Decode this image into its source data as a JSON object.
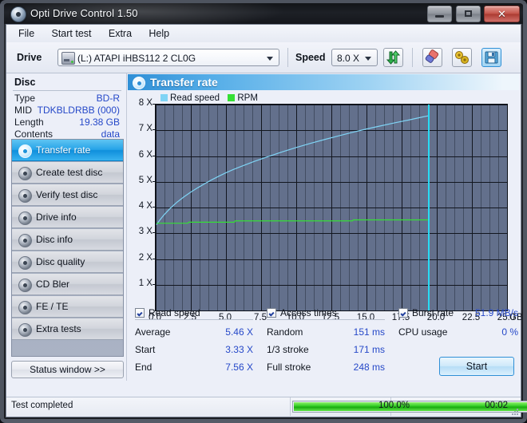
{
  "window": {
    "title": "Opti Drive Control 1.50",
    "app_icon": "disc-icon",
    "minimize": "minimize-icon",
    "maximize": "maximize-icon",
    "close": "✕"
  },
  "menubar": {
    "items": [
      {
        "label": "File"
      },
      {
        "label": "Start test"
      },
      {
        "label": "Extra"
      },
      {
        "label": "Help"
      }
    ]
  },
  "toolbar": {
    "drive_label": "Drive",
    "drive_value": "(L:)  ATAPI iHBS112  2 CL0G",
    "drive_icon": "optical-drive-icon",
    "speed_label": "Speed",
    "speed_value": "8.0 X",
    "refresh_icon": "refresh-icon",
    "eraser_icon": "eraser-icon",
    "settings_icon": "settings-icon",
    "save_icon": "save-icon"
  },
  "disc": {
    "title": "Disc",
    "rows": [
      {
        "key": "Type",
        "value": "BD-R"
      },
      {
        "key": "MID",
        "value": "TDKBLDRBB (000)"
      },
      {
        "key": "Length",
        "value": "19.38 GB"
      },
      {
        "key": "Contents",
        "value": "data"
      }
    ]
  },
  "nav": {
    "items": [
      {
        "label": "Transfer rate",
        "active": true
      },
      {
        "label": "Create test disc",
        "active": false
      },
      {
        "label": "Verify test disc",
        "active": false
      },
      {
        "label": "Drive info",
        "active": false
      },
      {
        "label": "Disc info",
        "active": false
      },
      {
        "label": "Disc quality",
        "active": false
      },
      {
        "label": "CD Bler",
        "active": false
      },
      {
        "label": "FE / TE",
        "active": false
      },
      {
        "label": "Extra tests",
        "active": false
      }
    ],
    "status_window_label": "Status window >>"
  },
  "panel": {
    "title": "Transfer rate",
    "icon": "disc-icon"
  },
  "chart_data": {
    "type": "line",
    "title": "Transfer rate",
    "xlabel": "GB",
    "ylabel": "X",
    "xlim": [
      0.0,
      25.0
    ],
    "ylim": [
      0,
      8
    ],
    "xticks": [
      "0.0",
      "2.5",
      "5.0",
      "7.5",
      "10.0",
      "12.5",
      "15.0",
      "17.5",
      "20.0",
      "22.5",
      "25.0"
    ],
    "xtick_values": [
      0.0,
      2.5,
      5.0,
      7.5,
      10.0,
      12.5,
      15.0,
      17.5,
      20.0,
      22.5,
      25.0
    ],
    "x_unit": "GB",
    "yticks": [
      "1 X",
      "2 X",
      "3 X",
      "4 X",
      "5 X",
      "6 X",
      "7 X",
      "8 X"
    ],
    "ytick_values": [
      1,
      2,
      3,
      4,
      5,
      6,
      7,
      8
    ],
    "grid": true,
    "legend": [
      {
        "name": "Read speed",
        "color": "#7fd4f5"
      },
      {
        "name": "RPM",
        "color": "#35e035"
      }
    ],
    "cursor_x": 19.38,
    "cursor_color": "#27dbf5",
    "plot_bg": "#63708c",
    "series": [
      {
        "name": "Read speed",
        "color": "#7fd4f5",
        "x": [
          0.05,
          0.3,
          0.6,
          1.0,
          1.5,
          2.0,
          2.5,
          3.0,
          3.5,
          4.0,
          4.5,
          5.0,
          5.5,
          6.0,
          7.0,
          8.0,
          9.0,
          10.0,
          11.0,
          12.0,
          13.0,
          14.0,
          15.0,
          16.0,
          17.0,
          18.0,
          19.0,
          19.38
        ],
        "y": [
          3.33,
          3.52,
          3.72,
          3.95,
          4.2,
          4.41,
          4.6,
          4.77,
          4.93,
          5.08,
          5.22,
          5.35,
          5.47,
          5.58,
          5.79,
          5.98,
          6.16,
          6.33,
          6.49,
          6.64,
          6.78,
          6.92,
          7.05,
          7.17,
          7.29,
          7.4,
          7.52,
          7.56
        ]
      },
      {
        "name": "RPM",
        "color": "#35e035",
        "x": [
          0.05,
          2.3,
          2.35,
          5.6,
          5.65,
          14.0,
          14.05,
          19.38
        ],
        "y": [
          3.39,
          3.39,
          3.43,
          3.43,
          3.48,
          3.48,
          3.52,
          3.52
        ]
      }
    ]
  },
  "results": {
    "read_speed": {
      "checkbox_checked": true,
      "label": "Read speed",
      "rows": [
        {
          "key": "Average",
          "value": "5.46 X"
        },
        {
          "key": "Start",
          "value": "3.33 X"
        },
        {
          "key": "End",
          "value": "7.56 X"
        }
      ]
    },
    "access_times": {
      "checkbox_checked": true,
      "label": "Access times",
      "rows": [
        {
          "key": "Random",
          "value": "151 ms"
        },
        {
          "key": "1/3 stroke",
          "value": "171 ms"
        },
        {
          "key": "Full stroke",
          "value": "248 ms"
        }
      ]
    },
    "burst_rate": {
      "checkbox_checked": true,
      "label": "Burst rate",
      "value": "51.9 MB/s",
      "rows": [
        {
          "key": "CPU usage",
          "value": "0 %"
        }
      ]
    },
    "start_button": "Start"
  },
  "statusbar": {
    "message": "Test completed",
    "progress_percent": "100.0%",
    "progress_value": 100,
    "elapsed": "00:02"
  }
}
